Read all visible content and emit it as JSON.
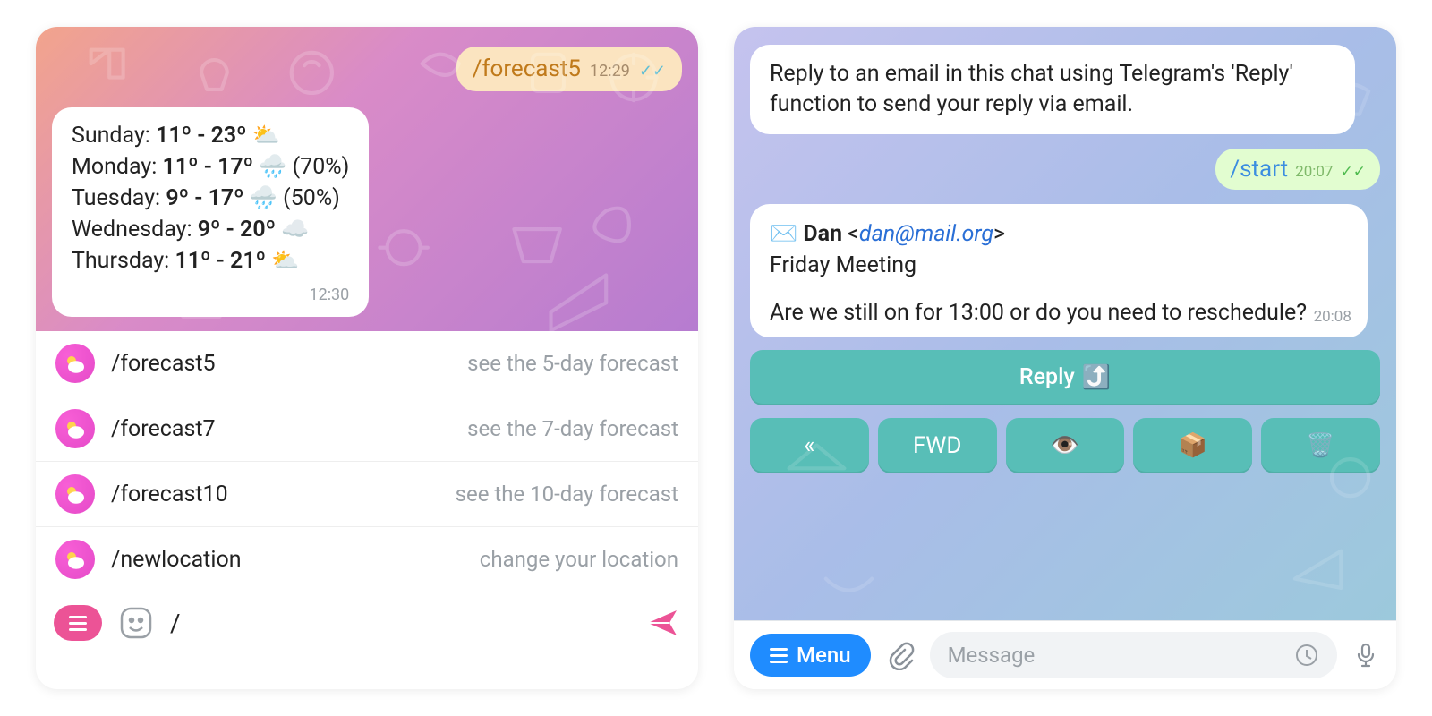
{
  "left": {
    "outgoing": {
      "text": "/forecast5",
      "time": "12:29"
    },
    "forecast": {
      "time": "12:30",
      "rows": [
        {
          "day": "Sunday",
          "temp": "11º - 23º",
          "icon": "⛅",
          "pct": ""
        },
        {
          "day": "Monday",
          "temp": "11º - 17º",
          "icon": "🌧️",
          "pct": "(70%)"
        },
        {
          "day": "Tuesday",
          "temp": "9º - 17º",
          "icon": "🌧️",
          "pct": "(50%)"
        },
        {
          "day": "Wednesday",
          "temp": "9º - 20º",
          "icon": "☁️",
          "pct": ""
        },
        {
          "day": "Thursday",
          "temp": "11º - 21º",
          "icon": "⛅",
          "pct": ""
        }
      ]
    },
    "commands": [
      {
        "name": "/forecast5",
        "desc": "see the 5-day forecast"
      },
      {
        "name": "/forecast7",
        "desc": "see the 7-day forecast"
      },
      {
        "name": "/forecast10",
        "desc": "see the 10-day forecast"
      },
      {
        "name": "/newlocation",
        "desc": "change your location"
      }
    ],
    "input_value": "/"
  },
  "right": {
    "info_text": "Reply to an email in this chat using Telegram's 'Reply' function to send your reply via email.",
    "outgoing": {
      "text": "/start",
      "time": "20:07"
    },
    "email": {
      "icon": "✉️",
      "from_name": "Dan",
      "from_addr": "dan@mail.org",
      "subject": "Friday Meeting",
      "body": "Are we still on for 13:00 or do you need to reschedule?",
      "time": "20:08"
    },
    "reply_button": {
      "label": "Reply",
      "icon": "⤴️"
    },
    "action_buttons": [
      {
        "label": "«"
      },
      {
        "label": "FWD"
      },
      {
        "label": "👁️"
      },
      {
        "label": "📦"
      },
      {
        "label": "🗑️"
      }
    ],
    "menu_label": "Menu",
    "input_placeholder": "Message"
  }
}
